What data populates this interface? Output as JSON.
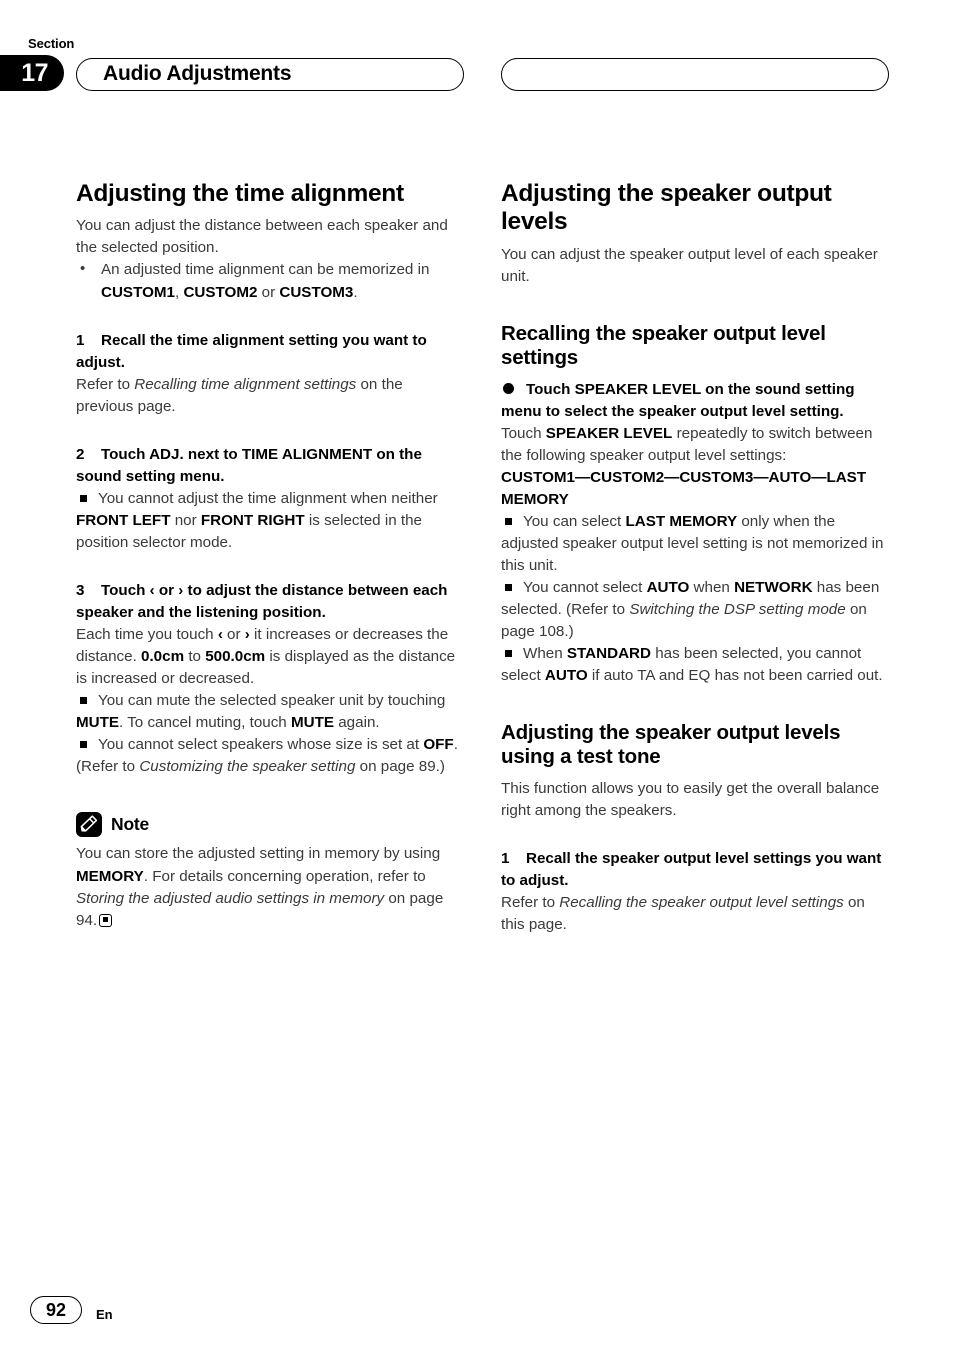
{
  "header": {
    "section_label": "Section",
    "section_number": "17",
    "chapter_title": "Audio Adjustments",
    "right_pill_title": ""
  },
  "footer": {
    "page_number": "92",
    "language": "En"
  },
  "left_column": {
    "title": "Adjusting the time alignment",
    "intro": "You can adjust the distance between each speaker and the selected position.",
    "intro_bullet": {
      "pre": "An adjusted time alignment can be memorized in ",
      "b1": "CUSTOM1",
      "mid1": ", ",
      "b2": "CUSTOM2",
      "mid2": " or ",
      "b3": "CUSTOM3",
      "post": "."
    },
    "step1": {
      "num": "1",
      "heading": "Recall the time alignment setting you want to adjust.",
      "body_pre": "Refer to ",
      "body_italic": "Recalling time alignment settings",
      "body_post": " on the previous page."
    },
    "step2": {
      "num": "2",
      "heading": "Touch ADJ. next to TIME ALIGNMENT on the sound setting menu.",
      "note_pre": "You cannot adjust the time alignment when neither ",
      "note_b1": "FRONT LEFT",
      "note_mid": " nor ",
      "note_b2": "FRONT RIGHT",
      "note_post": " is selected in the position selector mode."
    },
    "step3": {
      "num": "3",
      "heading_pre": "Touch ",
      "heading_chev_left": "‹",
      "heading_or": " or ",
      "heading_chev_right": "›",
      "heading_post": " to adjust the distance between each speaker and the listening position.",
      "body_pre": "Each time you touch ",
      "body_chev_left": "‹",
      "body_or": " or ",
      "body_chev_right": "›",
      "body_mid": " it increases or decreases the distance. ",
      "body_b1": "0.0cm",
      "body_to": " to ",
      "body_b2": "500.0cm",
      "body_post": " is displayed as the distance is increased or decreased.",
      "note1_pre": "You can mute the selected speaker unit by touching ",
      "note1_b1": "MUTE",
      "note1_mid": ". To cancel muting, touch ",
      "note1_b2": "MUTE",
      "note1_post": " again.",
      "note2_pre": "You cannot select speakers whose size is set at ",
      "note2_b1": "OFF",
      "note2_mid": ". (Refer to ",
      "note2_italic": "Customizing the speaker setting",
      "note2_post": " on page 89.)"
    },
    "note": {
      "icon": "pencil-icon",
      "label": "Note",
      "body_pre": "You can store the adjusted setting in memory by using ",
      "body_b1": "MEMORY",
      "body_mid": ". For details concerning operation, refer to ",
      "body_italic": "Storing the adjusted audio settings in memory",
      "body_post": " on page 94."
    }
  },
  "right_column": {
    "title": "Adjusting the speaker output levels",
    "intro": "You can adjust the speaker output level of each speaker unit.",
    "sub1": {
      "title": "Recalling the speaker output level settings",
      "bullet_heading": "Touch SPEAKER LEVEL on the sound setting menu to select the speaker output level setting.",
      "body_pre": "Touch ",
      "body_b1": "SPEAKER LEVEL",
      "body_post": " repeatedly to switch between the following speaker output level settings:",
      "settings_chain": "CUSTOM1—CUSTOM2—CUSTOM3—AUTO—LAST MEMORY",
      "note1_pre": "You can select ",
      "note1_b1": "LAST MEMORY",
      "note1_post": " only when the adjusted speaker output level setting is not memorized in this unit.",
      "note2_pre": "You cannot select ",
      "note2_b1": "AUTO",
      "note2_mid": " when ",
      "note2_b2": "NETWORK",
      "note2_mid2": " has been selected. (Refer to ",
      "note2_italic": "Switching the DSP setting mode",
      "note2_post": " on page 108.)",
      "note3_pre": "When ",
      "note3_b1": "STANDARD",
      "note3_mid": " has been selected, you cannot select ",
      "note3_b2": "AUTO",
      "note3_post": " if auto TA and EQ has not been carried out."
    },
    "sub2": {
      "title": "Adjusting the speaker output levels using a test tone",
      "intro": "This function allows you to easily get the overall balance right among the speakers.",
      "step1": {
        "num": "1",
        "heading": "Recall the speaker output level settings you want to adjust.",
        "body_pre": "Refer to ",
        "body_italic": "Recalling the speaker output level settings",
        "body_post": " on this page."
      }
    }
  }
}
